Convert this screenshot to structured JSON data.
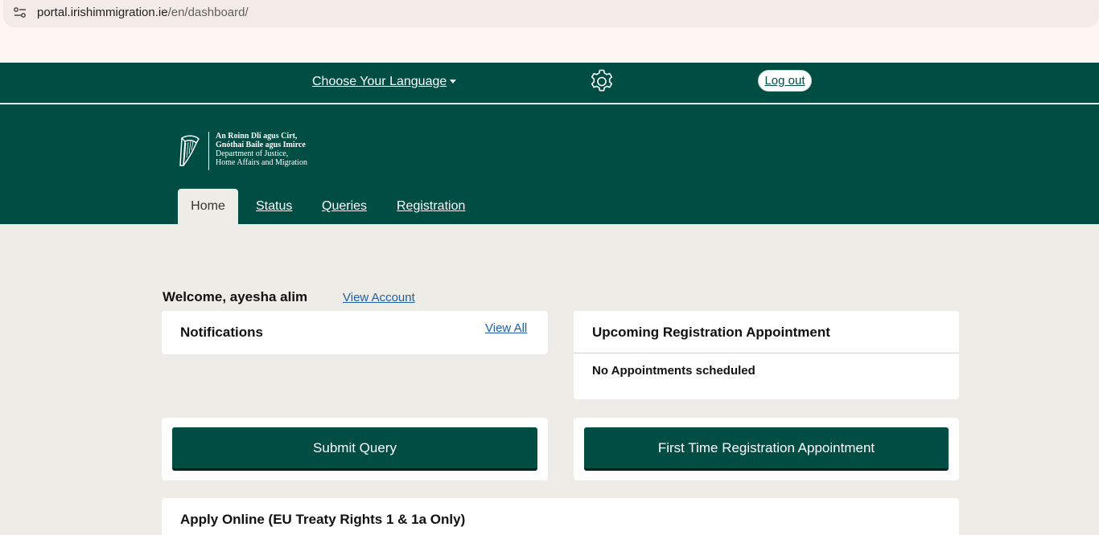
{
  "browser": {
    "url_host": "portal.irishimmigration.ie",
    "url_path": "/en/dashboard/"
  },
  "util_bar": {
    "language_label": "Choose Your Language",
    "logout_label": "Log out"
  },
  "logo": {
    "line1": "An Roinn Dlí agus Cirt,",
    "line2": "Gnóthaí Baile agus Imirce",
    "line3": "Department of Justice,",
    "line4": "Home Affairs and Migration"
  },
  "nav": {
    "tabs": [
      {
        "label": "Home",
        "active": true
      },
      {
        "label": "Status",
        "active": false
      },
      {
        "label": "Queries",
        "active": false
      },
      {
        "label": "Registration",
        "active": false
      }
    ]
  },
  "main": {
    "welcome": "Welcome, ayesha alim",
    "view_account": "View Account",
    "notifications": {
      "title": "Notifications",
      "view_all": "View All"
    },
    "appointment": {
      "title": "Upcoming Registration Appointment",
      "status": "No Appointments scheduled"
    },
    "submit_query_label": "Submit Query",
    "first_time_registration_label": "First Time Registration Appointment",
    "apply_online_title": "Apply Online (EU Treaty Rights 1 & 1a Only)"
  },
  "colors": {
    "brand_green": "#004d44",
    "page_bg": "#eeece6",
    "link_blue": "#1d5fa8"
  }
}
